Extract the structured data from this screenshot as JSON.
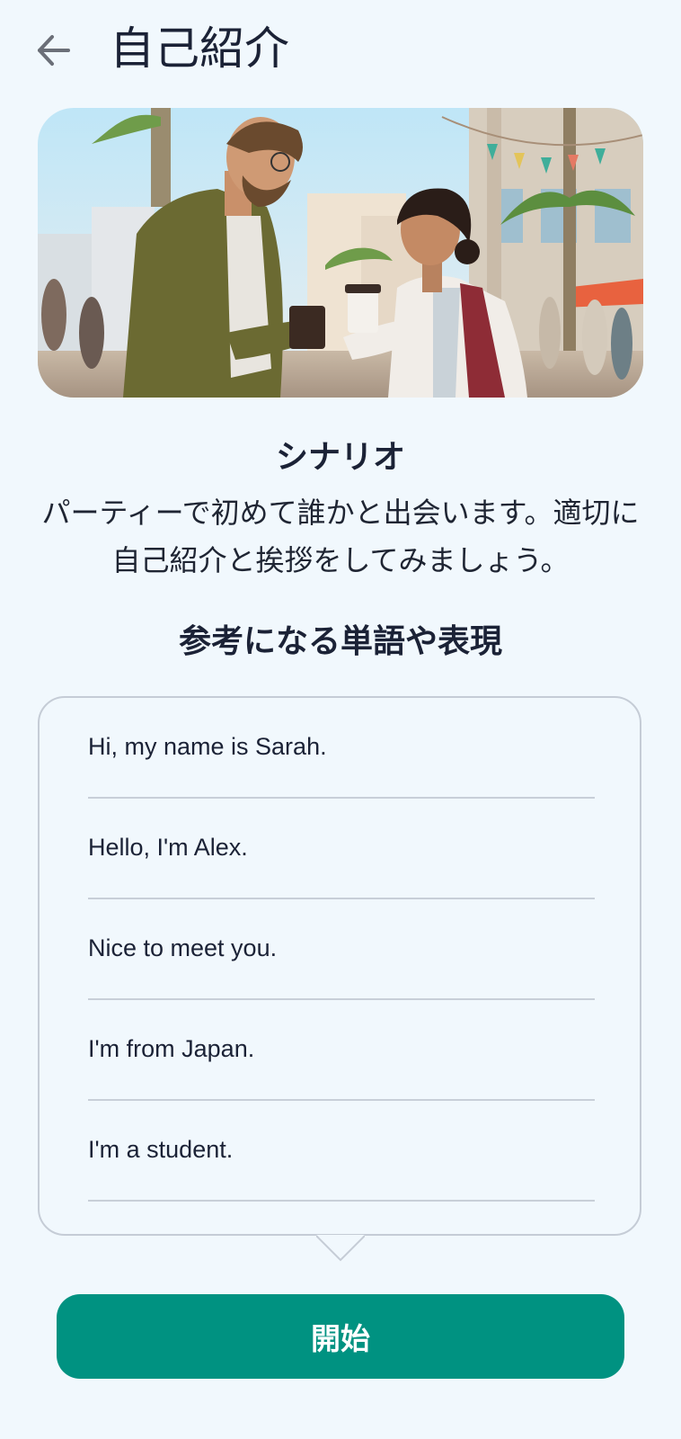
{
  "header": {
    "back_icon": "arrow-left-icon",
    "title": "自己紹介"
  },
  "hero": {
    "description": "illustration-two-people-meeting-with-coffee"
  },
  "scenario": {
    "heading": "シナリオ",
    "text": "パーティーで初めて誰かと出会います。適切に自己紹介と挨拶をしてみましょう。"
  },
  "vocabulary": {
    "heading": "参考になる単語や表現",
    "phrases": [
      "Hi, my name is Sarah.",
      "Hello, I'm Alex.",
      "Nice to meet you.",
      "I'm from Japan.",
      "I'm a student."
    ]
  },
  "actions": {
    "start_label": "開始"
  },
  "colors": {
    "background": "#f1f8fd",
    "primary": "#009281",
    "text": "#1b2236",
    "border": "#c5ccd6"
  }
}
